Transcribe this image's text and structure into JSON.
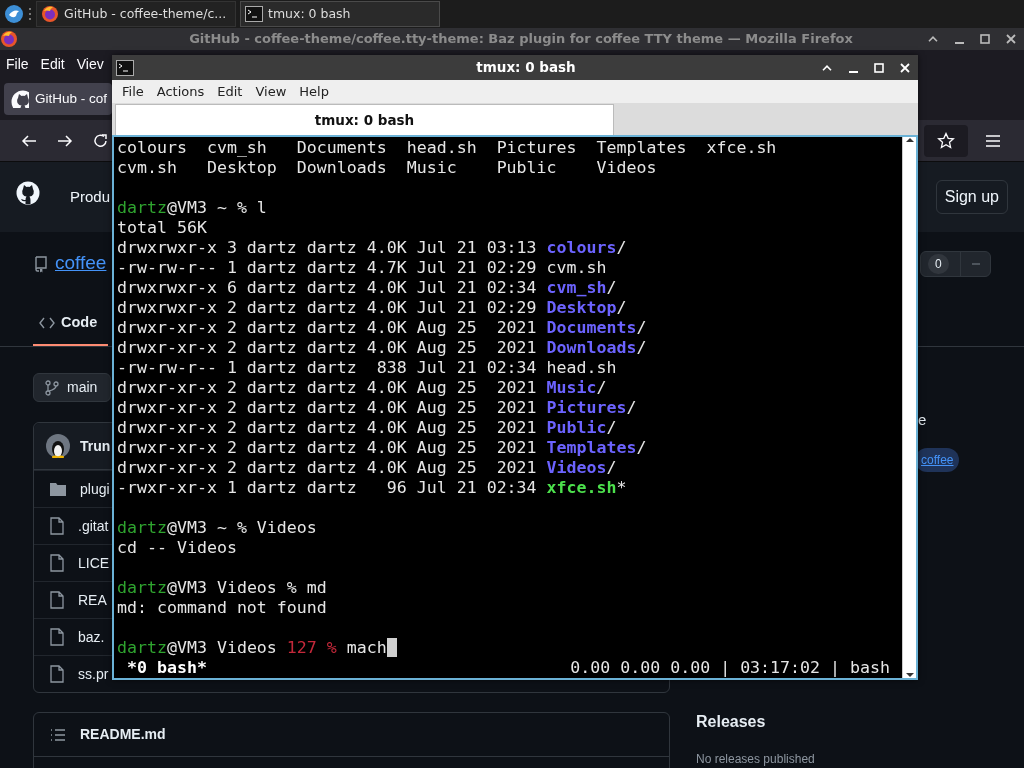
{
  "taskbar": {
    "tasks": [
      {
        "label": "GitHub - coffee-theme/c...",
        "kind": "browser",
        "selected": false
      },
      {
        "label": "tmux: 0 bash",
        "kind": "terminal",
        "selected": true
      }
    ]
  },
  "browser": {
    "title": "GitHub - coffee-theme/coffee.tty-theme: Baz plugin for coffee TTY theme — Mozilla Firefox",
    "menu": [
      "File",
      "Edit",
      "Viev"
    ],
    "tab": "GitHub - cof",
    "page": {
      "nav": "Produ",
      "signup": "Sign up",
      "repo": "coffee",
      "counter": "0",
      "code_tab": {
        "label": "Code",
        "selected": true
      },
      "branch": "main",
      "commit_author": "Trun",
      "files": [
        {
          "name": "plugi",
          "kind": "folder"
        },
        {
          "name": ".gitat",
          "kind": "file"
        },
        {
          "name": "LICE",
          "kind": "file"
        },
        {
          "name": "REA",
          "kind": "file"
        },
        {
          "name": "baz.",
          "kind": "file"
        },
        {
          "name": "ss.pr",
          "kind": "file"
        }
      ],
      "about_fragment": "e",
      "topic": "coffee",
      "readme": "README.md",
      "releases": {
        "title": "Releases",
        "note": "No releases published"
      }
    }
  },
  "terminal": {
    "title": "tmux: 0 bash",
    "menu": [
      "File",
      "Actions",
      "Edit",
      "View",
      "Help"
    ],
    "tabs": [
      {
        "label": "tmux: 0 bash",
        "selected": true
      }
    ],
    "lines": [
      {
        "segments": [
          {
            "kind": "plain",
            "text": "colours  cvm_sh   Documents  head.sh  Pictures  Templates  xfce.sh"
          }
        ]
      },
      {
        "segments": [
          {
            "kind": "plain",
            "text": "cvm.sh   Desktop  Downloads  Music    Public    Videos"
          }
        ]
      },
      {
        "blank_before": true,
        "segments": [
          {
            "kind": "user",
            "text": "dartz"
          },
          {
            "kind": "plain",
            "text": "@VM3 ~ % l"
          }
        ]
      },
      {
        "segments": [
          {
            "kind": "plain",
            "text": "total 56K"
          }
        ]
      },
      {
        "segments": [
          {
            "kind": "plain",
            "text": "drwxrwxr-x 3 dartz dartz 4.0K Jul 21 03:13 "
          },
          {
            "kind": "dir",
            "text": "colours"
          },
          {
            "kind": "plain",
            "text": "/"
          }
        ]
      },
      {
        "segments": [
          {
            "kind": "plain",
            "text": "-rw-rw-r-- 1 dartz dartz 4.7K Jul 21 02:29 cvm.sh"
          }
        ]
      },
      {
        "segments": [
          {
            "kind": "plain",
            "text": "drwxrwxr-x 6 dartz dartz 4.0K Jul 21 02:34 "
          },
          {
            "kind": "dir",
            "text": "cvm_sh"
          },
          {
            "kind": "plain",
            "text": "/"
          }
        ]
      },
      {
        "segments": [
          {
            "kind": "plain",
            "text": "drwxrwxr-x 2 dartz dartz 4.0K Jul 21 02:29 "
          },
          {
            "kind": "dir",
            "text": "Desktop"
          },
          {
            "kind": "plain",
            "text": "/"
          }
        ]
      },
      {
        "segments": [
          {
            "kind": "plain",
            "text": "drwxr-xr-x 2 dartz dartz 4.0K Aug 25  2021 "
          },
          {
            "kind": "dir",
            "text": "Documents"
          },
          {
            "kind": "plain",
            "text": "/"
          }
        ]
      },
      {
        "segments": [
          {
            "kind": "plain",
            "text": "drwxr-xr-x 2 dartz dartz 4.0K Aug 25  2021 "
          },
          {
            "kind": "dir",
            "text": "Downloads"
          },
          {
            "kind": "plain",
            "text": "/"
          }
        ]
      },
      {
        "segments": [
          {
            "kind": "plain",
            "text": "-rw-rw-r-- 1 dartz dartz  838 Jul 21 02:34 head.sh"
          }
        ]
      },
      {
        "segments": [
          {
            "kind": "plain",
            "text": "drwxr-xr-x 2 dartz dartz 4.0K Aug 25  2021 "
          },
          {
            "kind": "dir",
            "text": "Music"
          },
          {
            "kind": "plain",
            "text": "/"
          }
        ]
      },
      {
        "segments": [
          {
            "kind": "plain",
            "text": "drwxr-xr-x 2 dartz dartz 4.0K Aug 25  2021 "
          },
          {
            "kind": "dir",
            "text": "Pictures"
          },
          {
            "kind": "plain",
            "text": "/"
          }
        ]
      },
      {
        "segments": [
          {
            "kind": "plain",
            "text": "drwxr-xr-x 2 dartz dartz 4.0K Aug 25  2021 "
          },
          {
            "kind": "dir",
            "text": "Public"
          },
          {
            "kind": "plain",
            "text": "/"
          }
        ]
      },
      {
        "segments": [
          {
            "kind": "plain",
            "text": "drwxr-xr-x 2 dartz dartz 4.0K Aug 25  2021 "
          },
          {
            "kind": "dir",
            "text": "Templates"
          },
          {
            "kind": "plain",
            "text": "/"
          }
        ]
      },
      {
        "segments": [
          {
            "kind": "plain",
            "text": "drwxr-xr-x 2 dartz dartz 4.0K Aug 25  2021 "
          },
          {
            "kind": "dir",
            "text": "Videos"
          },
          {
            "kind": "plain",
            "text": "/"
          }
        ]
      },
      {
        "segments": [
          {
            "kind": "plain",
            "text": "-rwxr-xr-x 1 dartz dartz   96 Jul 21 02:34 "
          },
          {
            "kind": "exec",
            "text": "xfce.sh"
          },
          {
            "kind": "plain",
            "text": "*"
          }
        ]
      },
      {
        "blank_before": true,
        "segments": [
          {
            "kind": "user",
            "text": "dartz"
          },
          {
            "kind": "plain",
            "text": "@VM3 ~ % Videos"
          }
        ]
      },
      {
        "segments": [
          {
            "kind": "plain",
            "text": "cd -- Videos"
          }
        ]
      },
      {
        "blank_before": true,
        "segments": [
          {
            "kind": "user",
            "text": "dartz"
          },
          {
            "kind": "plain",
            "text": "@VM3 Videos % md"
          }
        ]
      },
      {
        "segments": [
          {
            "kind": "plain",
            "text": "md: command not found"
          }
        ]
      },
      {
        "blank_before": true,
        "cursor": true,
        "segments": [
          {
            "kind": "user",
            "text": "dartz"
          },
          {
            "kind": "plain",
            "text": "@VM3 Videos "
          },
          {
            "kind": "error",
            "text": "127 %"
          },
          {
            "kind": "plain",
            "text": " mach"
          }
        ]
      }
    ],
    "status": {
      "left": " *0 bash*",
      "right": "0.00 0.00 0.00 | 03:17:02 | bash"
    }
  }
}
